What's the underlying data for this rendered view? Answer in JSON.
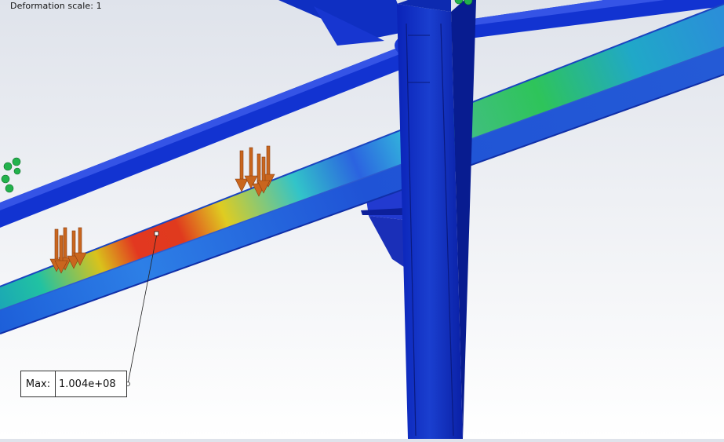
{
  "viewport": {
    "deformation_label": "Deformation scale: 1",
    "probe": {
      "key": "Max:",
      "value": "1.004e+08"
    }
  },
  "colors": {
    "background_top": "#dfe3eb",
    "low_stress": "#0b22c8",
    "mid_stress": "#19b24a",
    "high_stress": "#e0261c",
    "load_arrow": "#c9661e",
    "fixture": "#22b24c"
  }
}
